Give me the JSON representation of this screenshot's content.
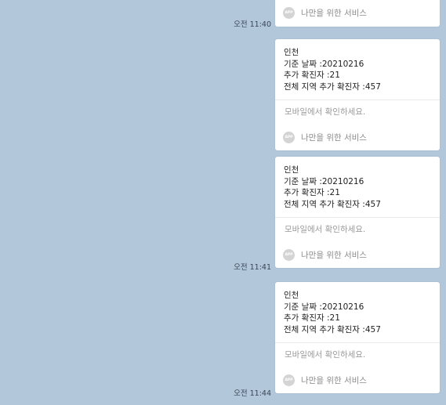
{
  "messages": [
    {
      "body_lines": [],
      "mobile_note": "",
      "footer_label": "나만을 위한 서비스",
      "app_icon_text": "APP",
      "timestamp": "오전 11:40"
    },
    {
      "body_lines": [
        "인천",
        "기준 날짜 :20210216",
        "추가 확진자 :21",
        "전체 지역 추가 확진자 :457"
      ],
      "mobile_note": "모바일에서 확인하세요.",
      "footer_label": "나만을 위한 서비스",
      "app_icon_text": "APP",
      "timestamp": ""
    },
    {
      "body_lines": [
        "인천",
        "기준 날짜 :20210216",
        "추가 확진자 :21",
        "전체 지역 추가 확진자 :457"
      ],
      "mobile_note": "모바일에서 확인하세요.",
      "footer_label": "나만을 위한 서비스",
      "app_icon_text": "APP",
      "timestamp": "오전 11:41"
    },
    {
      "body_lines": [
        "인천",
        "기준 날짜 :20210216",
        "추가 확진자 :21",
        "전체 지역 추가 확진자 :457"
      ],
      "mobile_note": "모바일에서 확인하세요.",
      "footer_label": "나만을 위한 서비스",
      "app_icon_text": "APP",
      "timestamp": "오전 11:44"
    }
  ]
}
